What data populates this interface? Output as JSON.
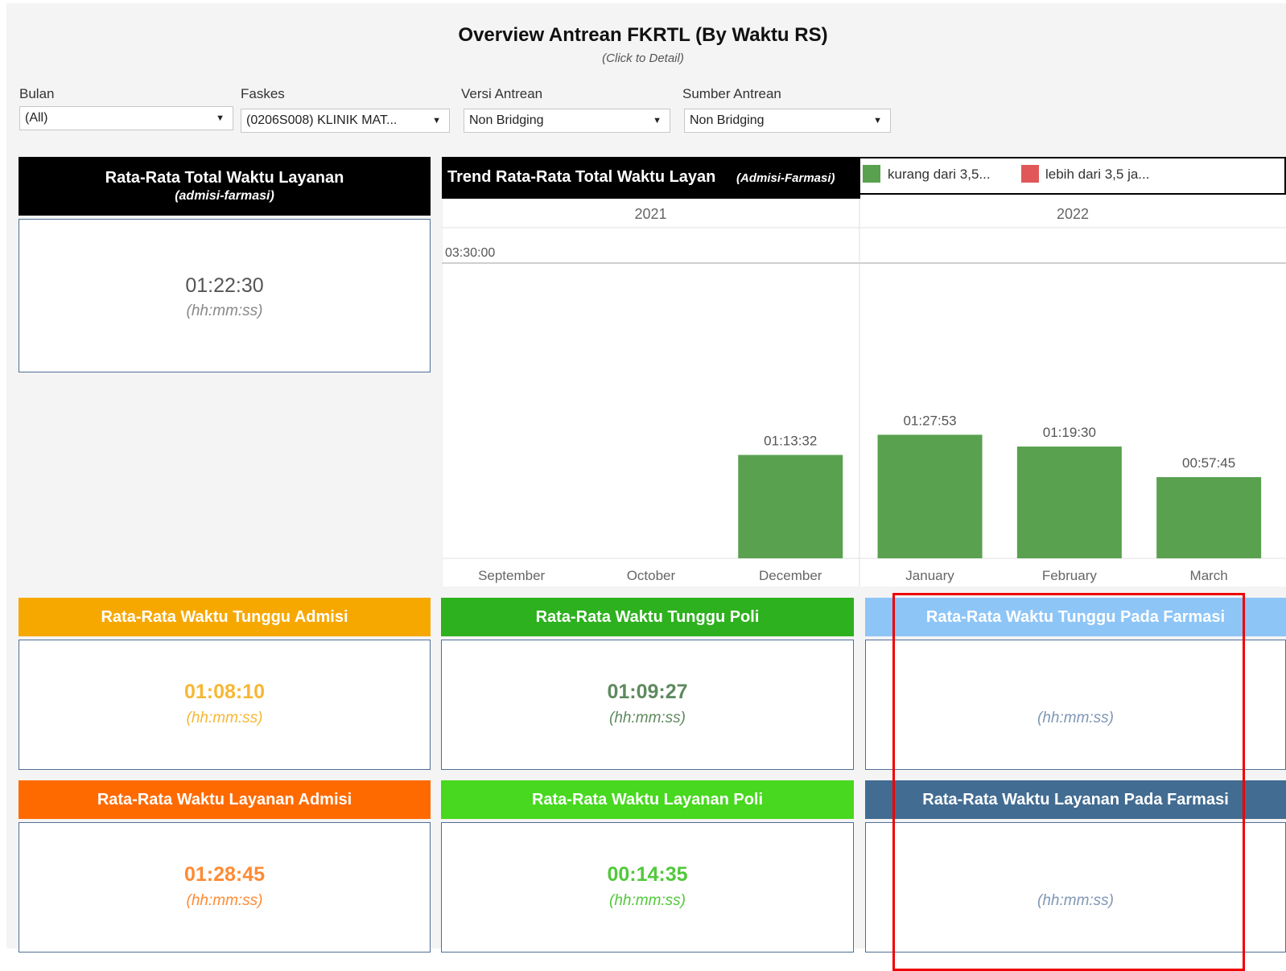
{
  "header": {
    "title": "Overview Antrean FKRTL (By Waktu RS)",
    "subtitle": "(Click to Detail)"
  },
  "filters": {
    "bulan": {
      "label": "Bulan",
      "value": "(All)"
    },
    "faskes": {
      "label": "Faskes",
      "value": "(0206S008) KLINIK MAT..."
    },
    "versi": {
      "label": "Versi Antrean",
      "value": "Non Bridging"
    },
    "sumber": {
      "label": "Sumber Antrean",
      "value": "Non Bridging"
    }
  },
  "total_card": {
    "title": "Rata-Rata Total Waktu Layanan",
    "subtitle": "(admisi-farmasi)",
    "value": "01:22:30",
    "unit": "(hh:mm:ss)"
  },
  "trend": {
    "title": "Trend Rata-Rata Total Waktu Layan",
    "title_suffix": "(Admisi-Farmasi)",
    "legend": [
      {
        "label": "kurang dari 3,5...",
        "color": "#59a14f"
      },
      {
        "label": "lebih dari 3,5 ja...",
        "color": "#e15759"
      }
    ]
  },
  "chart_data": {
    "type": "bar",
    "years": [
      "2021",
      "2022"
    ],
    "categories": [
      "September",
      "October",
      "December",
      "January",
      "February",
      "March"
    ],
    "category_years": [
      "2021",
      "2021",
      "2021",
      "2022",
      "2022",
      "2022"
    ],
    "values": [
      null,
      null,
      "01:13:32",
      "01:27:53",
      "01:19:30",
      "00:57:45"
    ],
    "reference_line": "03:30:00",
    "bar_color": "#59a14f",
    "grid": false
  },
  "cards": [
    {
      "id": "tunggu-admisi",
      "title": "Rata-Rata Waktu Tunggu Admisi",
      "value": "01:08:10",
      "unit": "(hh:mm:ss)",
      "head_color": "#f7a800",
      "value_color": "#f7b733"
    },
    {
      "id": "tunggu-poli",
      "title": "Rata-Rata Waktu Tunggu Poli",
      "value": "01:09:27",
      "unit": "(hh:mm:ss)",
      "head_color": "#2db11e",
      "value_color": "#5e8a5e"
    },
    {
      "id": "tunggu-farmasi",
      "title": "Rata-Rata Waktu Tunggu Pada Farmasi",
      "value": "",
      "unit": "(hh:mm:ss)",
      "head_color": "#8ec5f7",
      "value_color": "#7f97b6"
    },
    {
      "id": "layanan-admisi",
      "title": "Rata-Rata Waktu Layanan Admisi",
      "value": "01:28:45",
      "unit": "(hh:mm:ss)",
      "head_color": "#ff6a00",
      "value_color": "#ff8a33"
    },
    {
      "id": "layanan-poli",
      "title": "Rata-Rata Waktu Layanan Poli",
      "value": "00:14:35",
      "unit": "(hh:mm:ss)",
      "head_color": "#47d81f",
      "value_color": "#52c83c"
    },
    {
      "id": "layanan-farmasi",
      "title": "Rata-Rata Waktu Layanan Pada Farmasi",
      "value": "",
      "unit": "(hh:mm:ss)",
      "head_color": "#426c92",
      "value_color": "#7f97b6"
    }
  ],
  "annotation": {
    "color": "#ee0000"
  }
}
